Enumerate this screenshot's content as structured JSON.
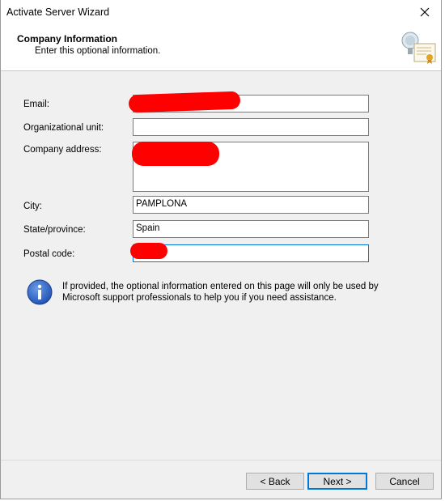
{
  "window": {
    "title": "Activate Server Wizard"
  },
  "header": {
    "title": "Company Information",
    "subtitle": "Enter this optional information."
  },
  "form": {
    "email_label": "Email:",
    "email_value": "",
    "org_unit_label": "Organizational unit:",
    "org_unit_value": "",
    "address_label": "Company address:",
    "address_value": "",
    "city_label": "City:",
    "city_value": "PAMPLONA",
    "state_label": "State/province:",
    "state_value": "Spain",
    "postal_label": "Postal code:",
    "postal_value": ""
  },
  "info": {
    "text": "If provided, the optional information entered on this page will only be used by Microsoft support professionals to help you if you need assistance."
  },
  "buttons": {
    "back": "< Back",
    "next": "Next >",
    "cancel": "Cancel"
  },
  "icons": {
    "close": "close-icon",
    "header": "server-certificate-icon",
    "info": "info-icon"
  },
  "colors": {
    "focus": "#0078d7",
    "redaction": "#ff0000"
  }
}
